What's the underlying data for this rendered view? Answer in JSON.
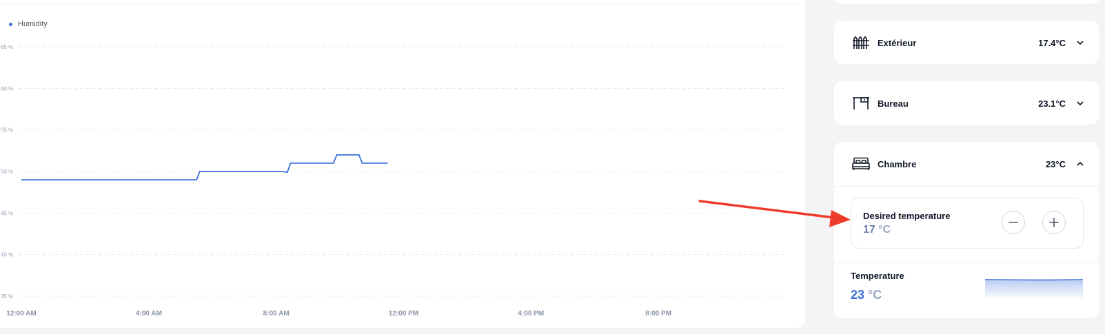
{
  "chart": {
    "legend_label": "Humidity",
    "y_ticks": [
      "65 %",
      "60 %",
      "55 %",
      "50 %",
      "45 %",
      "40 %",
      "35 %"
    ],
    "x_ticks": [
      "12:00 AM",
      "4:00 AM",
      "8:00 AM",
      "12:00 PM",
      "4:00 PM",
      "8:00 PM"
    ]
  },
  "chart_data": {
    "type": "line",
    "series": [
      {
        "name": "Humidity",
        "color": "#3b6fd9",
        "x_hours": [
          0,
          5.5,
          5.6,
          8.2,
          8.35,
          8.45,
          9.8,
          9.9,
          10.6,
          10.7,
          11.5
        ],
        "values": [
          49,
          49,
          50,
          50,
          49.9,
          51,
          51,
          52,
          52,
          51,
          51
        ]
      }
    ],
    "ylim": [
      35,
      65
    ],
    "x_range_hours": [
      0,
      24
    ],
    "grid": true,
    "legend": "top-left"
  },
  "rooms": [
    {
      "name": "Extérieur",
      "temp": "17.4°C",
      "icon": "fence-icon",
      "expanded": false
    },
    {
      "name": "Bureau",
      "temp": "23.1°C",
      "icon": "desk-icon",
      "expanded": false
    },
    {
      "name": "Chambre",
      "temp": "23°C",
      "icon": "bed-icon",
      "expanded": true
    }
  ],
  "chambre": {
    "desired_label": "Desired temperature",
    "desired_value": "17",
    "desired_unit": "°C",
    "temperature_label": "Temperature",
    "temperature_value": "23",
    "temperature_unit": "°C"
  },
  "colors": {
    "accent": "#3b6fd9",
    "annotation_arrow": "#ef3b2c"
  }
}
